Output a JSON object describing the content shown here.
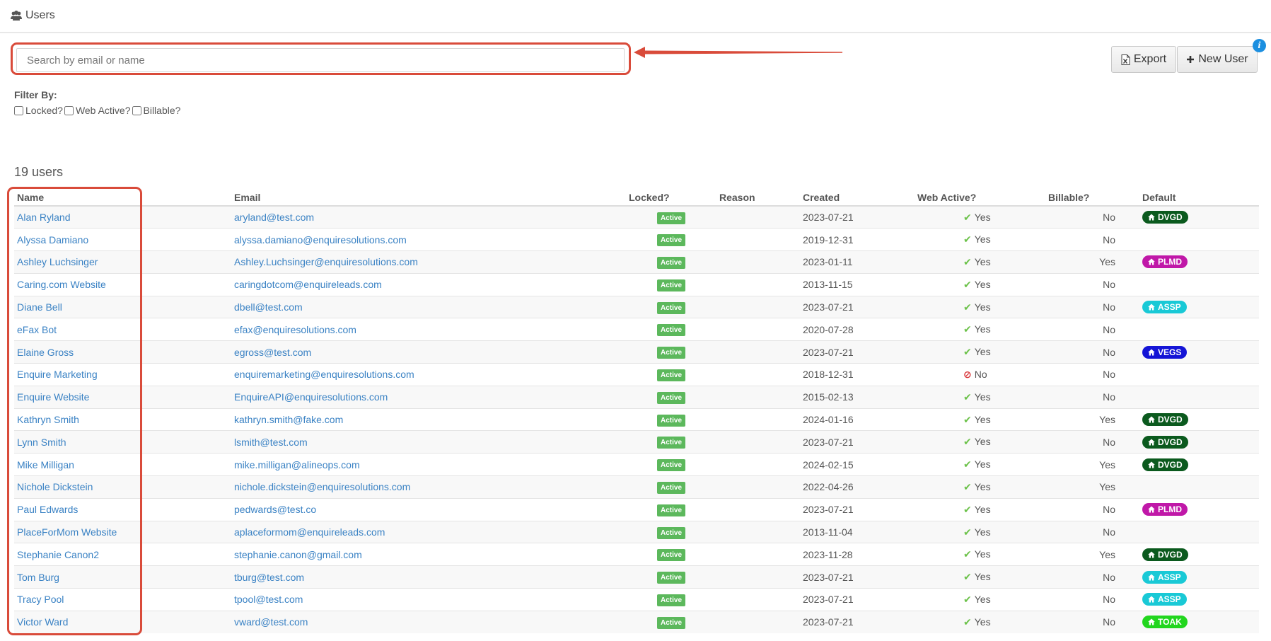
{
  "page": {
    "title": "Users",
    "title_icon": "users-icon"
  },
  "search": {
    "placeholder": "Search by email or name",
    "value": ""
  },
  "toolbar": {
    "export_label": "Export",
    "export_icon": "excel-file-icon",
    "new_user_label": "New User",
    "new_user_icon": "plus-icon",
    "info_icon": "info-icon"
  },
  "filters": {
    "label": "Filter By:",
    "options": [
      {
        "label": "Locked?",
        "checked": false
      },
      {
        "label": "Web Active?",
        "checked": false
      },
      {
        "label": "Billable?",
        "checked": false
      }
    ]
  },
  "summary": {
    "count_text": "19 users"
  },
  "table": {
    "columns": [
      "Name",
      "Email",
      "Locked?",
      "Reason",
      "Created",
      "Web Active?",
      "Billable?",
      "Default"
    ],
    "rows": [
      {
        "name": "Alan Ryland",
        "email": "aryland@test.com",
        "locked": "Active",
        "reason": "",
        "created": "2023-07-21",
        "web_active": "Yes",
        "billable": "No",
        "default": "DVGD",
        "default_color": "#0b5a1e"
      },
      {
        "name": "Alyssa Damiano",
        "email": "alyssa.damiano@enquiresolutions.com",
        "locked": "Active",
        "reason": "",
        "created": "2019-12-31",
        "web_active": "Yes",
        "billable": "No",
        "default": "",
        "default_color": ""
      },
      {
        "name": "Ashley Luchsinger",
        "email": "Ashley.Luchsinger@enquiresolutions.com",
        "locked": "Active",
        "reason": "",
        "created": "2023-01-11",
        "web_active": "Yes",
        "billable": "Yes",
        "default": "PLMD",
        "default_color": "#c018a8"
      },
      {
        "name": "Caring.com Website",
        "email": "caringdotcom@enquireleads.com",
        "locked": "Active",
        "reason": "",
        "created": "2013-11-15",
        "web_active": "Yes",
        "billable": "No",
        "default": "",
        "default_color": ""
      },
      {
        "name": "Diane Bell",
        "email": "dbell@test.com",
        "locked": "Active",
        "reason": "",
        "created": "2023-07-21",
        "web_active": "Yes",
        "billable": "No",
        "default": "ASSP",
        "default_color": "#19c9d6"
      },
      {
        "name": "eFax Bot",
        "email": "efax@enquiresolutions.com",
        "locked": "Active",
        "reason": "",
        "created": "2020-07-28",
        "web_active": "Yes",
        "billable": "No",
        "default": "",
        "default_color": ""
      },
      {
        "name": "Elaine Gross",
        "email": "egross@test.com",
        "locked": "Active",
        "reason": "",
        "created": "2023-07-21",
        "web_active": "Yes",
        "billable": "No",
        "default": "VEGS",
        "default_color": "#1414d6"
      },
      {
        "name": "Enquire Marketing",
        "email": "enquiremarketing@enquiresolutions.com",
        "locked": "Active",
        "reason": "",
        "created": "2018-12-31",
        "web_active": "No",
        "billable": "No",
        "default": "",
        "default_color": ""
      },
      {
        "name": "Enquire Website",
        "email": "EnquireAPI@enquiresolutions.com",
        "locked": "Active",
        "reason": "",
        "created": "2015-02-13",
        "web_active": "Yes",
        "billable": "No",
        "default": "",
        "default_color": ""
      },
      {
        "name": "Kathryn Smith",
        "email": "kathryn.smith@fake.com",
        "locked": "Active",
        "reason": "",
        "created": "2024-01-16",
        "web_active": "Yes",
        "billable": "Yes",
        "default": "DVGD",
        "default_color": "#0b5a1e"
      },
      {
        "name": "Lynn Smith",
        "email": "lsmith@test.com",
        "locked": "Active",
        "reason": "",
        "created": "2023-07-21",
        "web_active": "Yes",
        "billable": "No",
        "default": "DVGD",
        "default_color": "#0b5a1e"
      },
      {
        "name": "Mike Milligan",
        "email": "mike.milligan@alineops.com",
        "locked": "Active",
        "reason": "",
        "created": "2024-02-15",
        "web_active": "Yes",
        "billable": "Yes",
        "default": "DVGD",
        "default_color": "#0b5a1e"
      },
      {
        "name": "Nichole Dickstein",
        "email": "nichole.dickstein@enquiresolutions.com",
        "locked": "Active",
        "reason": "",
        "created": "2022-04-26",
        "web_active": "Yes",
        "billable": "Yes",
        "default": "",
        "default_color": ""
      },
      {
        "name": "Paul Edwards",
        "email": "pedwards@test.co",
        "locked": "Active",
        "reason": "",
        "created": "2023-07-21",
        "web_active": "Yes",
        "billable": "No",
        "default": "PLMD",
        "default_color": "#c018a8"
      },
      {
        "name": "PlaceForMom Website",
        "email": "aplaceformom@enquireleads.com",
        "locked": "Active",
        "reason": "",
        "created": "2013-11-04",
        "web_active": "Yes",
        "billable": "No",
        "default": "",
        "default_color": ""
      },
      {
        "name": "Stephanie Canon2",
        "email": "stephanie.canon@gmail.com",
        "locked": "Active",
        "reason": "",
        "created": "2023-11-28",
        "web_active": "Yes",
        "billable": "Yes",
        "default": "DVGD",
        "default_color": "#0b5a1e"
      },
      {
        "name": "Tom Burg",
        "email": "tburg@test.com",
        "locked": "Active",
        "reason": "",
        "created": "2023-07-21",
        "web_active": "Yes",
        "billable": "No",
        "default": "ASSP",
        "default_color": "#19c9d6"
      },
      {
        "name": "Tracy Pool",
        "email": "tpool@test.com",
        "locked": "Active",
        "reason": "",
        "created": "2023-07-21",
        "web_active": "Yes",
        "billable": "No",
        "default": "ASSP",
        "default_color": "#19c9d6"
      },
      {
        "name": "Victor Ward",
        "email": "vward@test.com",
        "locked": "Active",
        "reason": "",
        "created": "2023-07-21",
        "web_active": "Yes",
        "billable": "No",
        "default": "TOAK",
        "default_color": "#22d61e"
      }
    ]
  },
  "colors": {
    "highlight": "#d94b3a",
    "link": "#3a82c4",
    "active_badge": "#5cb85c",
    "check": "#6cc24a",
    "ban": "#d9373b",
    "info": "#1c8fe0"
  }
}
